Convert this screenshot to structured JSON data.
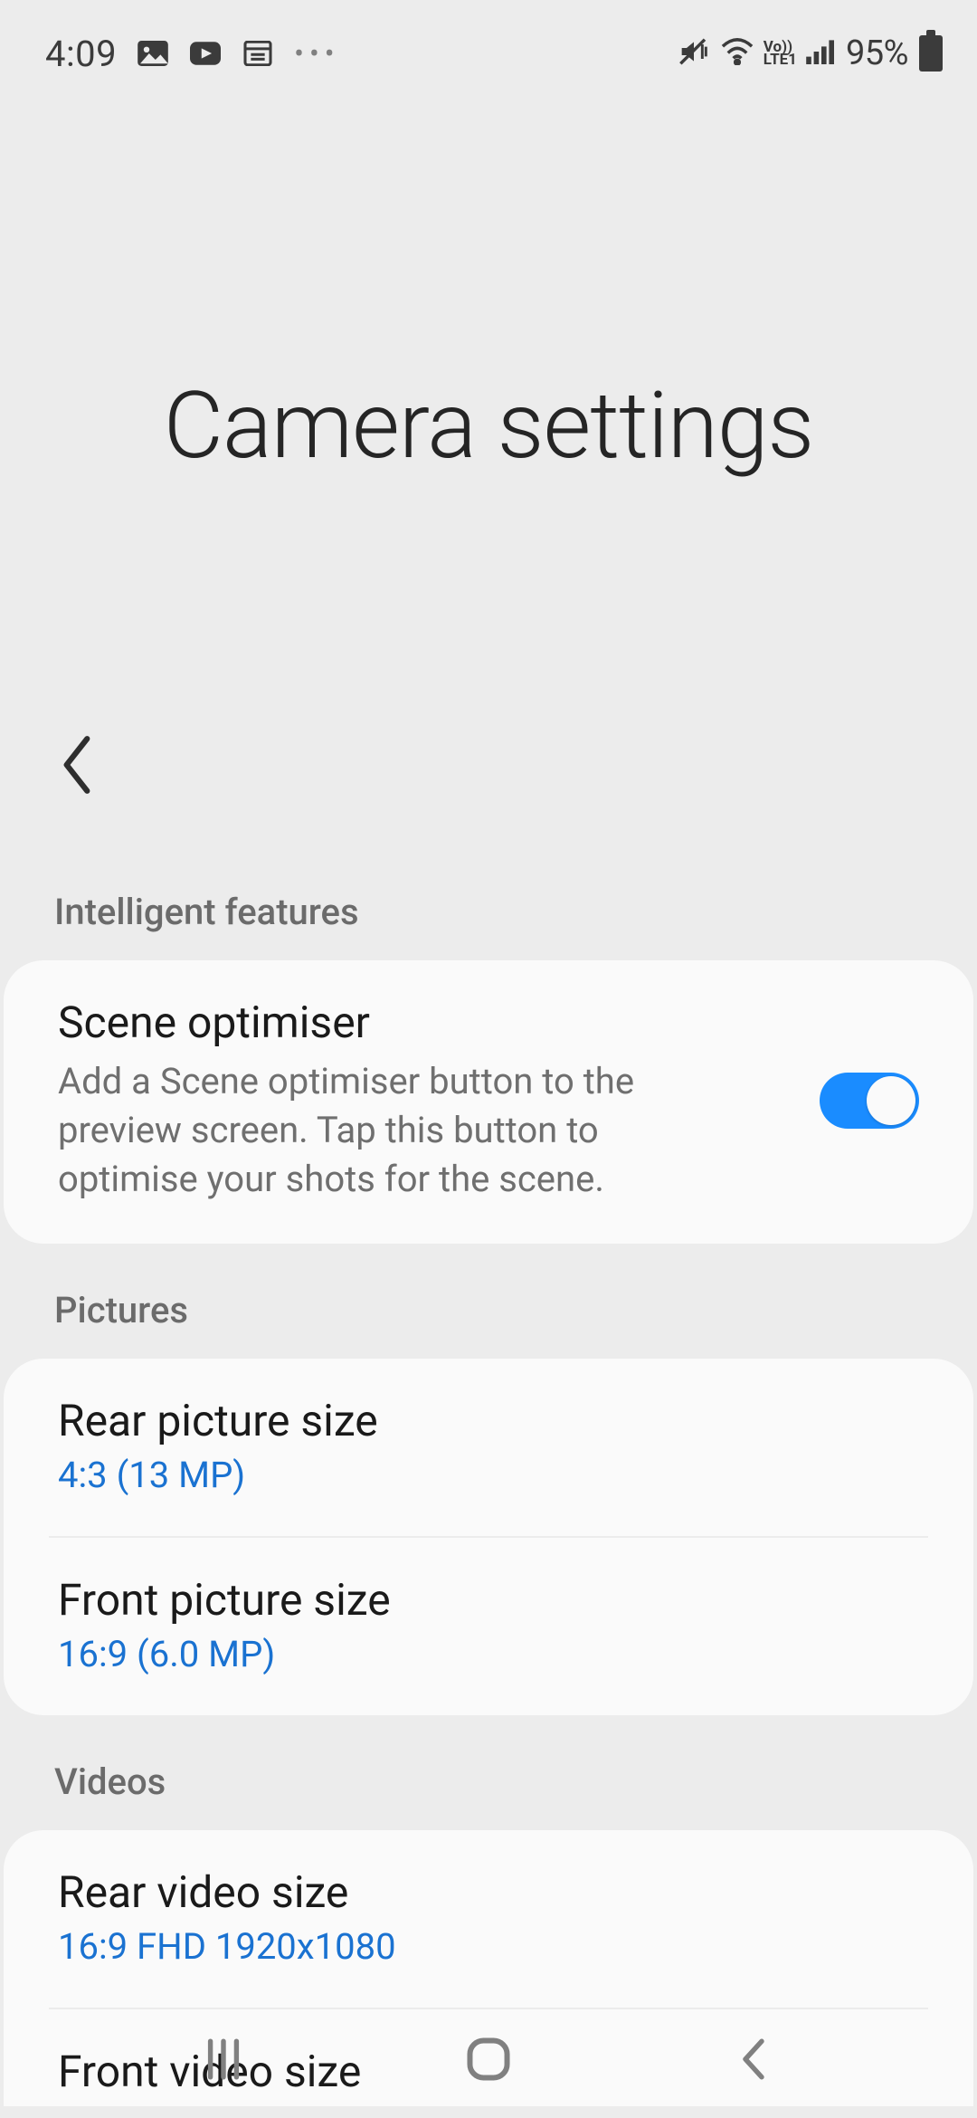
{
  "status": {
    "time": "4:09",
    "battery_pct": "95%"
  },
  "page": {
    "title": "Camera settings"
  },
  "sections": {
    "intelligent": {
      "header": "Intelligent features",
      "scene_optimiser": {
        "title": "Scene optimiser",
        "desc": "Add a Scene optimiser button to the preview screen. Tap this button to optimise your shots for the scene.",
        "enabled": true
      }
    },
    "pictures": {
      "header": "Pictures",
      "rear": {
        "title": "Rear picture size",
        "value": "4:3 (13 MP)"
      },
      "front": {
        "title": "Front picture size",
        "value": "16:9 (6.0 MP)"
      }
    },
    "videos": {
      "header": "Videos",
      "rear": {
        "title": "Rear video size",
        "value": "16:9 FHD 1920x1080"
      },
      "front": {
        "title": "Front video size"
      }
    }
  }
}
